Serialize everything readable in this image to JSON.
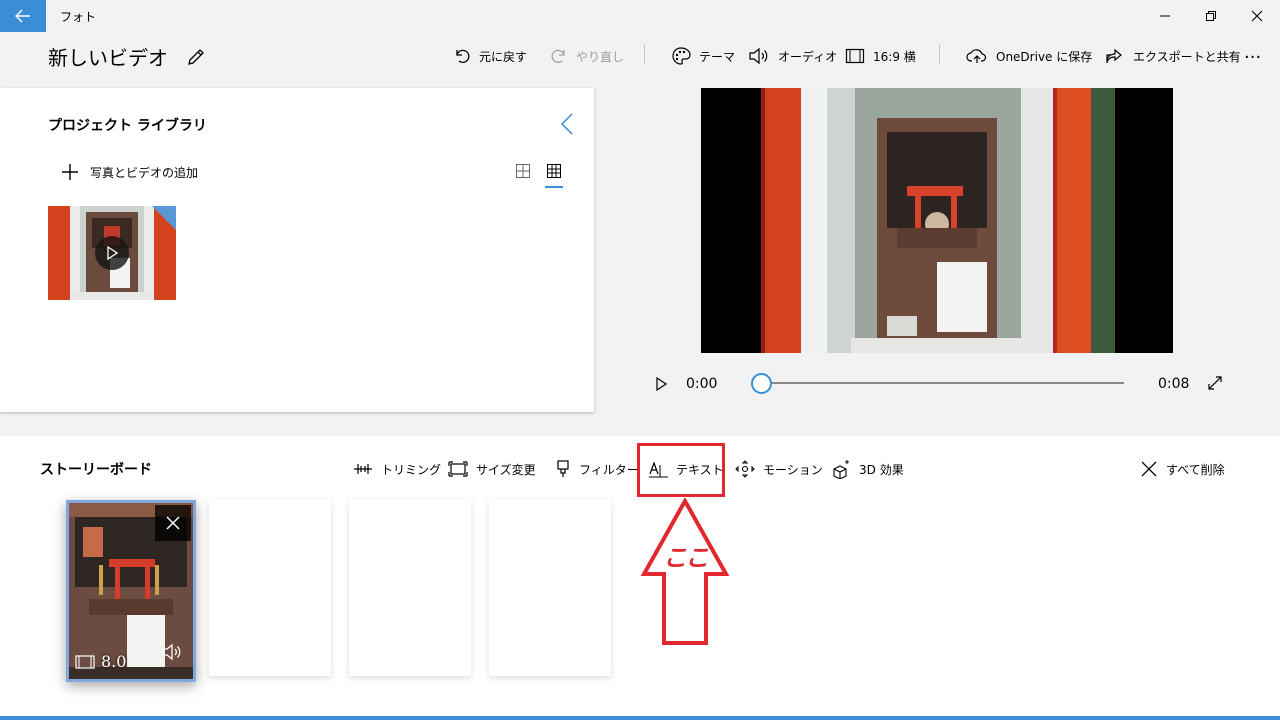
{
  "titlebar": {
    "app_title": "フォト"
  },
  "project": {
    "title": "新しいビデオ"
  },
  "commands": {
    "undo": "元に戻す",
    "redo": "やり直し",
    "theme": "テーマ",
    "audio": "オーディオ",
    "aspect": "16:9 横",
    "save_onedrive": "OneDrive に保存",
    "export_share": "エクスポートと共有",
    "more": "..."
  },
  "library": {
    "title": "プロジェクト ライブラリ",
    "add_media": "写真とビデオの追加"
  },
  "player": {
    "current_time": "0:00",
    "end_time": "0:08",
    "progress": 0
  },
  "storyboard": {
    "title": "ストーリーボード",
    "tools": {
      "trim": "トリミング",
      "resize": "サイズ変更",
      "filter": "フィルター",
      "text": "テキスト",
      "motion": "モーション",
      "effects3d": "3D 効果",
      "remove_all": "すべて削除"
    },
    "clip_duration": "8.0"
  },
  "annotation": {
    "label": "ここ"
  },
  "colors": {
    "accent": "#3b8ed6",
    "annotation_red": "#e0282e"
  }
}
